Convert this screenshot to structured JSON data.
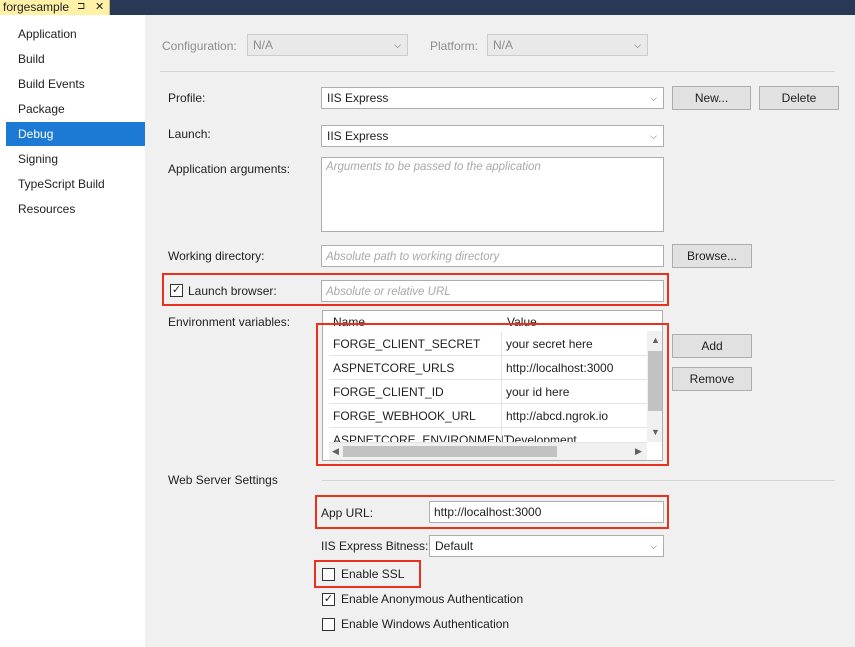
{
  "window": {
    "tab_title": "forgesample",
    "pin_glyph": "⊐",
    "close_glyph": "✕"
  },
  "sidebar": {
    "items": [
      {
        "label": "Application"
      },
      {
        "label": "Build"
      },
      {
        "label": "Build Events"
      },
      {
        "label": "Package"
      },
      {
        "label": "Debug",
        "selected": true
      },
      {
        "label": "Signing"
      },
      {
        "label": "TypeScript Build"
      },
      {
        "label": "Resources"
      }
    ]
  },
  "config": {
    "configuration_label": "Configuration:",
    "configuration_value": "N/A",
    "platform_label": "Platform:",
    "platform_value": "N/A"
  },
  "debug": {
    "profile_label": "Profile:",
    "profile_value": "IIS Express",
    "new_button": "New...",
    "delete_button": "Delete",
    "launch_label": "Launch:",
    "launch_value": "IIS Express",
    "app_args_label": "Application arguments:",
    "app_args_placeholder": "Arguments to be passed to the application",
    "working_dir_label": "Working directory:",
    "working_dir_placeholder": "Absolute path to working directory",
    "browse_button": "Browse...",
    "launch_browser_label": "Launch browser:",
    "launch_browser_checked": true,
    "launch_browser_placeholder": "Absolute or relative URL",
    "env_label": "Environment variables:",
    "add_button": "Add",
    "remove_button": "Remove"
  },
  "env_grid": {
    "columns": [
      "Name",
      "Value"
    ],
    "rows": [
      {
        "name": "FORGE_CLIENT_SECRET",
        "value": "your secret here"
      },
      {
        "name": "ASPNETCORE_URLS",
        "value": "http://localhost:3000"
      },
      {
        "name": "FORGE_CLIENT_ID",
        "value": "your id here"
      },
      {
        "name": "FORGE_WEBHOOK_URL",
        "value": "http://abcd.ngrok.io"
      },
      {
        "name": "ASPNETCORE_ENVIRONMENT",
        "value": "Development"
      }
    ]
  },
  "web_server": {
    "section_label": "Web Server Settings",
    "app_url_label": "App URL:",
    "app_url_value": "http://localhost:3000",
    "bitness_label": "IIS Express Bitness:",
    "bitness_value": "Default",
    "enable_ssl_label": "Enable SSL",
    "enable_ssl_checked": false,
    "anon_auth_label": "Enable Anonymous Authentication",
    "anon_auth_checked": true,
    "windows_auth_label": "Enable Windows Authentication",
    "windows_auth_checked": false
  },
  "icons": {
    "dropdown": "chevron-down-icon",
    "check": "checkmark-icon"
  },
  "colors": {
    "selection": "#1c7ad4",
    "highlight": "#e8321e",
    "titlebar": "#293955",
    "tab": "#fff1a8"
  }
}
